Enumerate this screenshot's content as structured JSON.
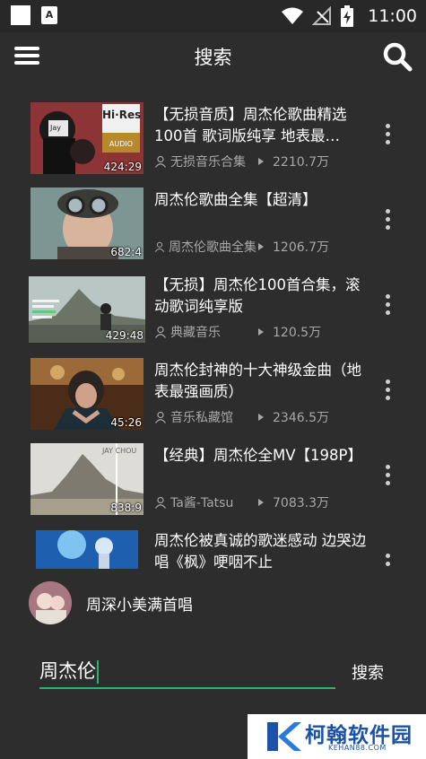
{
  "status_bar": {
    "time": "11:00",
    "icons": [
      "app-square-icon",
      "font-a-icon",
      "wifi-icon",
      "no-signal-icon",
      "battery-charging-icon"
    ]
  },
  "app_bar": {
    "title": "搜索",
    "menu_icon": "hamburger-menu-icon",
    "search_icon": "magnifier-icon"
  },
  "results": [
    {
      "title": "【无损音质】周杰伦歌曲精选100首 歌词版纯享 地表最…",
      "author": "无损音乐合集",
      "views": "2210.7万",
      "duration": "424:29"
    },
    {
      "title": "周杰伦歌曲全集【超清】",
      "author": "周杰伦歌曲全集",
      "views": "1206.7万",
      "duration": "682:4"
    },
    {
      "title": "【无损】周杰伦100首合集，滚动歌词纯享版",
      "author": "典藏音乐",
      "views": "120.5万",
      "duration": "429:48"
    },
    {
      "title": "周杰伦封神的十大神级金曲（地表最强画质）",
      "author": "音乐私藏馆",
      "views": "2346.5万",
      "duration": "45:26"
    },
    {
      "title": "【经典】周杰伦全MV【198P】",
      "author": "Ta酱-Tatsu",
      "views": "7083.3万",
      "duration": "838:9"
    },
    {
      "title": "周杰伦被真诚的歌迷感动 边哭边唱《枫》哽咽不止",
      "author": "",
      "views": "",
      "duration": ""
    }
  ],
  "thumb_badges": {
    "hires_top": "Hi·Res",
    "hires_bottom": "AUDIO",
    "jay_cap": "Jay",
    "jay_chou_cover": "JAY CHOU"
  },
  "suggestion": {
    "text": "周深小美满首唱"
  },
  "search": {
    "value": "周杰伦",
    "button_label": "搜索"
  },
  "watermark": {
    "brand": "柯翰软件园",
    "domain": "KEHAN88.COM"
  },
  "colors": {
    "background": "#2d2d2d",
    "accent": "#2eb36b",
    "muted_text": "#a8a8a8",
    "watermark": "#1a52a8"
  }
}
